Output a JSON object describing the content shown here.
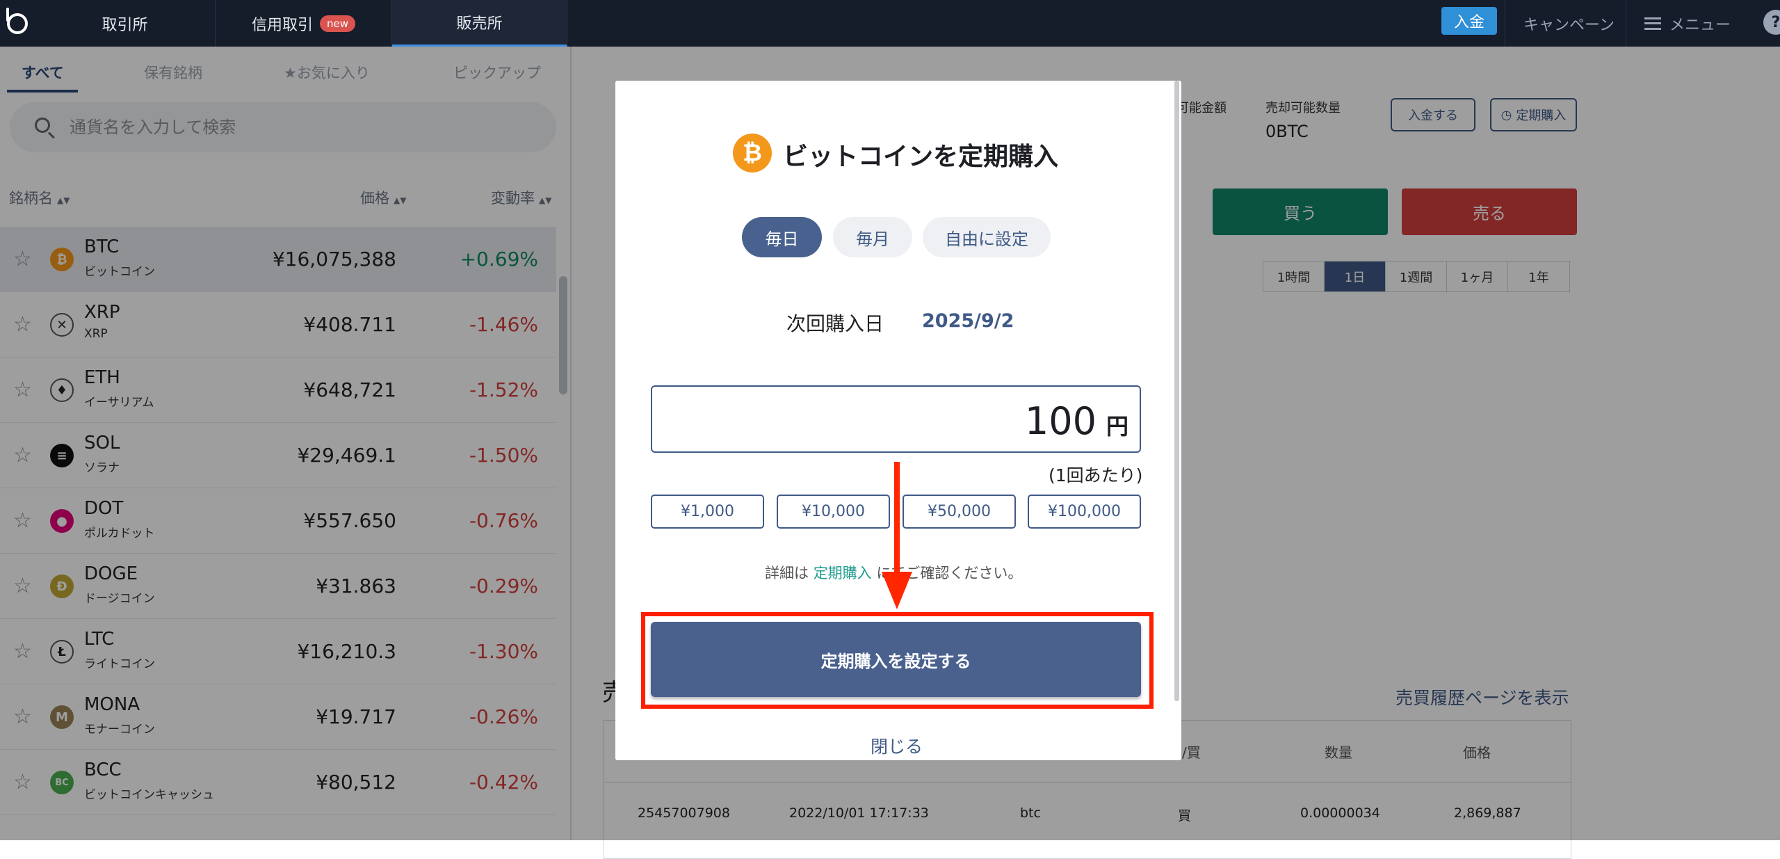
{
  "topbar": {
    "nav": [
      "取引所",
      "信用取引",
      "販売所"
    ],
    "new_badge": "new",
    "deposit": "入金",
    "campaign": "キャンペーン",
    "menu": "メニュー",
    "help": "?"
  },
  "left": {
    "tabs": [
      "すべて",
      "保有銘柄",
      "★お気に入り",
      "ピックアップ"
    ],
    "search_placeholder": "通貨名を入力して検索",
    "headers": {
      "name": "銘柄名",
      "price": "価格",
      "change": "変動率"
    },
    "coins": [
      {
        "symbol": "BTC",
        "name": "ビットコイン",
        "price": "¥16,075,388",
        "change": "+0.69%",
        "color": "#f4981b",
        "glyph": "₿"
      },
      {
        "symbol": "XRP",
        "name": "XRP",
        "price": "¥408.711",
        "change": "-1.46%",
        "color": "#ffffff",
        "glyph": "✕"
      },
      {
        "symbol": "ETH",
        "name": "イーサリアム",
        "price": "¥648,721",
        "change": "-1.52%",
        "color": "#ffffff",
        "glyph": "♦"
      },
      {
        "symbol": "SOL",
        "name": "ソラナ",
        "price": "¥29,469.1",
        "change": "-1.50%",
        "color": "#111111",
        "glyph": "≡"
      },
      {
        "symbol": "DOT",
        "name": "ポルカドット",
        "price": "¥557.650",
        "change": "-0.76%",
        "color": "#e6007a",
        "glyph": "●"
      },
      {
        "symbol": "DOGE",
        "name": "ドージコイン",
        "price": "¥31.863",
        "change": "-0.29%",
        "color": "#c2a633",
        "glyph": "Đ"
      },
      {
        "symbol": "LTC",
        "name": "ライトコイン",
        "price": "¥16,210.3",
        "change": "-1.30%",
        "color": "#ffffff",
        "glyph": "Ł"
      },
      {
        "symbol": "MONA",
        "name": "モナーコイン",
        "price": "¥19.717",
        "change": "-0.26%",
        "color": "#9c8457",
        "glyph": "M"
      },
      {
        "symbol": "BCC",
        "name": "ビットコインキャッシュ",
        "price": "¥80,512",
        "change": "-0.42%",
        "color": "#4cae4f",
        "glyph": "BC"
      }
    ]
  },
  "right": {
    "buyable_label": "可能金額",
    "sellable_label": "売却可能数量",
    "sellable_value": "0BTC",
    "deposit_btn": "入金する",
    "recurring_btn": "定期購入",
    "buy": "買う",
    "sell": "売る",
    "periods": [
      "1時間",
      "1日",
      "1週間",
      "1ヶ月",
      "1年"
    ],
    "history_title_partial": "売",
    "history_link": "売買履歴ページを表示",
    "table_headers": {
      "side": "/買",
      "qty": "数量",
      "price": "価格"
    },
    "row": {
      "id": "25457007908",
      "datetime": "2022/10/01 17:17:33",
      "pair": "btc",
      "side": "買",
      "qty": "0.00000034",
      "price": "2,869,887"
    }
  },
  "modal": {
    "title": "ビットコインを定期購入",
    "frequencies": [
      "毎日",
      "毎月",
      "自由に設定"
    ],
    "next_label": "次回購入日",
    "next_date": "2025/9/2",
    "amount": "100",
    "unit": "円",
    "per_time": "(1回あたり)",
    "presets": [
      "¥1,000",
      "¥10,000",
      "¥50,000",
      "¥100,000"
    ],
    "detail_prefix": "詳細は",
    "detail_link": "定期購入",
    "detail_suffix": "にてご確認ください。",
    "cta": "定期購入を設定する",
    "close": "閉じる"
  },
  "colors": {
    "accent": "#4a618e",
    "up": "#0f8a5f",
    "down": "#d2403d",
    "highlight": "#ff1f00"
  }
}
